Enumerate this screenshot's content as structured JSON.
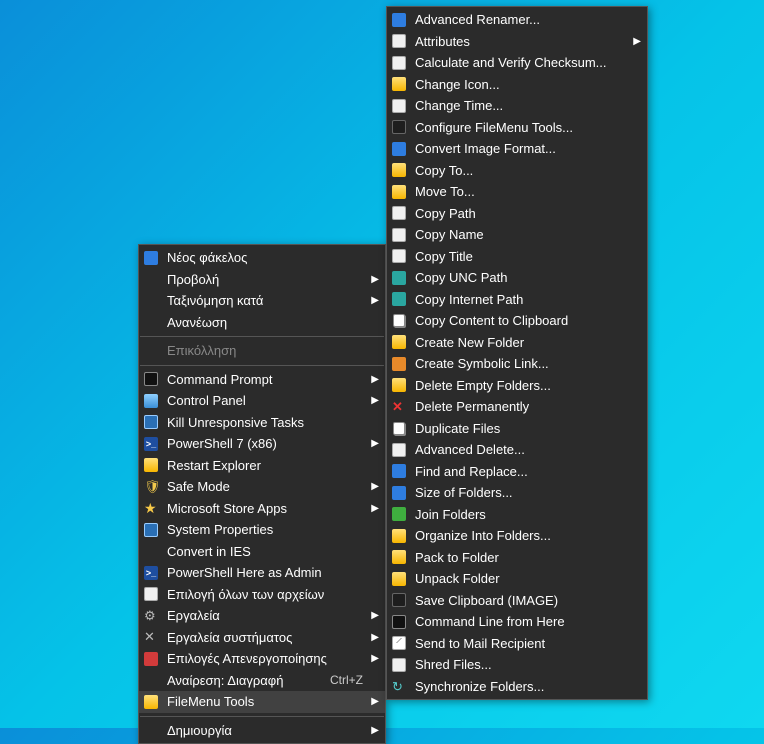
{
  "left_menu": {
    "groups": [
      [
        {
          "id": "new-folder",
          "label": "Νέος φάκελος",
          "icon": "ic-blue",
          "shortcut": "",
          "submenu": false
        },
        {
          "id": "view",
          "label": "Προβολή",
          "icon": "",
          "shortcut": "",
          "submenu": true
        },
        {
          "id": "sort",
          "label": "Ταξινόμηση κατά",
          "icon": "",
          "shortcut": "",
          "submenu": true
        },
        {
          "id": "refresh",
          "label": "Ανανέωση",
          "icon": "",
          "shortcut": "",
          "submenu": false
        }
      ],
      [
        {
          "id": "paste",
          "label": "Επικόλληση",
          "icon": "",
          "shortcut": "",
          "submenu": false,
          "disabled": true
        }
      ],
      [
        {
          "id": "command-prompt",
          "label": "Command Prompt",
          "icon": "ic-cmd",
          "shortcut": "",
          "submenu": true
        },
        {
          "id": "control-panel",
          "label": "Control Panel",
          "icon": "ic-ctrl",
          "shortcut": "",
          "submenu": true
        },
        {
          "id": "kill-tasks",
          "label": "Kill Unresponsive Tasks",
          "icon": "ic-mon",
          "shortcut": "",
          "submenu": false
        },
        {
          "id": "powershell7",
          "label": "PowerShell 7 (x86)",
          "icon": "ic-powerb",
          "icon_text": ">_",
          "shortcut": "",
          "submenu": true
        },
        {
          "id": "restart-explorer",
          "label": "Restart Explorer",
          "icon": "ic-folder",
          "shortcut": "",
          "submenu": false
        },
        {
          "id": "safe-mode",
          "label": "Safe Mode",
          "icon": "ic-shield",
          "icon_text": "🛡",
          "shortcut": "",
          "submenu": true
        },
        {
          "id": "ms-store-apps",
          "label": "Microsoft Store Apps",
          "icon": "ic-star",
          "icon_text": "★",
          "shortcut": "",
          "submenu": true
        },
        {
          "id": "system-properties",
          "label": "System Properties",
          "icon": "ic-mon",
          "shortcut": "",
          "submenu": false
        },
        {
          "id": "convert-ies",
          "label": "Convert in IES",
          "icon": "",
          "shortcut": "",
          "submenu": false
        },
        {
          "id": "powershell-admin",
          "label": "PowerShell Here as Admin",
          "icon": "ic-powerb",
          "icon_text": ">_",
          "shortcut": "",
          "submenu": false
        },
        {
          "id": "select-all-files",
          "label": "Επιλογή όλων των αρχείων",
          "icon": "ic-white",
          "shortcut": "",
          "submenu": false
        },
        {
          "id": "tools",
          "label": "Εργαλεία",
          "icon": "ic-gear",
          "icon_text": "⚙",
          "shortcut": "",
          "submenu": true
        },
        {
          "id": "system-tools",
          "label": "Εργαλεία συστήματος",
          "icon": "ic-gear",
          "icon_text": "✕",
          "shortcut": "",
          "submenu": true
        },
        {
          "id": "power-options",
          "label": "Επιλογές Απενεργοποίησης",
          "icon": "ic-red",
          "shortcut": "",
          "submenu": true
        },
        {
          "id": "undo-delete",
          "label": "Αναίρεση: Διαγραφή",
          "icon": "",
          "shortcut": "Ctrl+Z",
          "submenu": false
        },
        {
          "id": "filemenu-tools",
          "label": "FileMenu Tools",
          "icon": "ic-folder",
          "shortcut": "",
          "submenu": true,
          "highlighted": true
        }
      ],
      [
        {
          "id": "create",
          "label": "Δημιουργία",
          "icon": "",
          "shortcut": "",
          "submenu": true
        }
      ]
    ]
  },
  "right_menu": {
    "items": [
      {
        "id": "advanced-renamer",
        "label": "Advanced Renamer...",
        "icon": "ic-blue"
      },
      {
        "id": "attributes",
        "label": "Attributes",
        "icon": "ic-white",
        "submenu": true
      },
      {
        "id": "calculate-checksum",
        "label": "Calculate and Verify Checksum...",
        "icon": "ic-white"
      },
      {
        "id": "change-icon",
        "label": "Change Icon...",
        "icon": "ic-folder"
      },
      {
        "id": "change-time",
        "label": "Change Time...",
        "icon": "ic-white"
      },
      {
        "id": "configure-fmt",
        "label": "Configure FileMenu Tools...",
        "icon": "ic-dark"
      },
      {
        "id": "convert-image-format",
        "label": "Convert Image Format...",
        "icon": "ic-blue"
      },
      {
        "id": "copy-to",
        "label": "Copy To...",
        "icon": "ic-folder"
      },
      {
        "id": "move-to",
        "label": "Move To...",
        "icon": "ic-folder"
      },
      {
        "id": "copy-path",
        "label": "Copy Path",
        "icon": "ic-white"
      },
      {
        "id": "copy-name",
        "label": "Copy Name",
        "icon": "ic-white"
      },
      {
        "id": "copy-title",
        "label": "Copy Title",
        "icon": "ic-white"
      },
      {
        "id": "copy-unc-path",
        "label": "Copy UNC Path",
        "icon": "ic-teal"
      },
      {
        "id": "copy-internet-path",
        "label": "Copy Internet Path",
        "icon": "ic-teal"
      },
      {
        "id": "copy-content-clipboard",
        "label": "Copy Content to Clipboard",
        "icon": "ic-copy"
      },
      {
        "id": "create-new-folder",
        "label": "Create New Folder",
        "icon": "ic-folder"
      },
      {
        "id": "create-symbolic-link",
        "label": "Create Symbolic Link...",
        "icon": "ic-orange"
      },
      {
        "id": "delete-empty-folders",
        "label": "Delete Empty Folders...",
        "icon": "ic-folder"
      },
      {
        "id": "delete-permanently",
        "label": "Delete Permanently",
        "icon": "ic-redx",
        "icon_text": "✕"
      },
      {
        "id": "duplicate-files",
        "label": "Duplicate Files",
        "icon": "ic-copy"
      },
      {
        "id": "advanced-delete",
        "label": "Advanced Delete...",
        "icon": "ic-white"
      },
      {
        "id": "find-replace",
        "label": "Find and Replace...",
        "icon": "ic-blue"
      },
      {
        "id": "size-of-folders",
        "label": "Size of Folders...",
        "icon": "ic-blue"
      },
      {
        "id": "join-folders",
        "label": "Join Folders",
        "icon": "ic-green"
      },
      {
        "id": "organize-into-folders",
        "label": "Organize Into Folders...",
        "icon": "ic-folder"
      },
      {
        "id": "pack-to-folder",
        "label": "Pack to Folder",
        "icon": "ic-folder"
      },
      {
        "id": "unpack-folder",
        "label": "Unpack Folder",
        "icon": "ic-folder"
      },
      {
        "id": "save-clipboard-image",
        "label": "Save Clipboard (IMAGE)",
        "icon": "ic-dark"
      },
      {
        "id": "command-line-here",
        "label": "Command Line from Here",
        "icon": "ic-cmd"
      },
      {
        "id": "send-mail",
        "label": "Send to Mail Recipient",
        "icon": "ic-mail"
      },
      {
        "id": "shred-files",
        "label": "Shred Files...",
        "icon": "ic-white"
      },
      {
        "id": "synchronize-folders",
        "label": "Synchronize Folders...",
        "icon": "ic-refresh",
        "icon_text": "↻"
      }
    ]
  }
}
